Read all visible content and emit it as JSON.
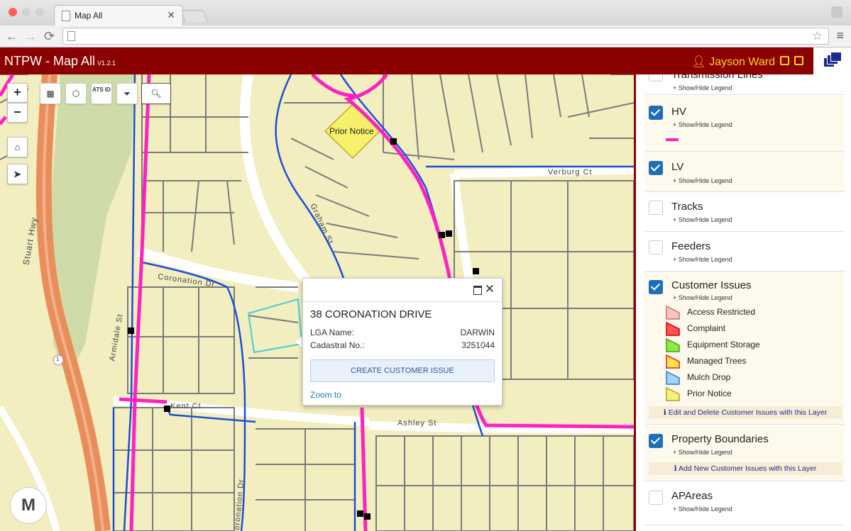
{
  "browser": {
    "tab_title": "Map All",
    "tab_close": "✕"
  },
  "app": {
    "name": "NTPW - Map All",
    "version": "V1.2.1",
    "user": "Jayson Ward",
    "colors": {
      "header": "#8b0000",
      "accent": "#ffd21a"
    }
  },
  "map": {
    "zoom_in": "+",
    "zoom_out": "−",
    "tools": {
      "grid_icon": "grid-icon",
      "lasso_icon": "lasso-icon",
      "ats_label": "ATS ID",
      "filter_icon": "filter-icon",
      "search_icon": "search-icon"
    },
    "feature_label": "Prior Notice",
    "street_labels": {
      "verburg": "Verburg Ct",
      "graham": "Graham St",
      "coronation": "Coronation Dr",
      "armidale": "Armidale St",
      "kent": "Kent Ct",
      "ashley": "Ashley St",
      "stuart": "Stuart Hwy",
      "coronation_lower": "Coronation Dr",
      "route": "1"
    }
  },
  "popup": {
    "title": "38 CORONATION DRIVE",
    "lga_label": "LGA Name:",
    "lga_value": "DARWIN",
    "cadastral_label": "Cadastral No.:",
    "cadastral_value": "3251044",
    "button": "CREATE CUSTOMER ISSUE",
    "zoom_link": "Zoom to"
  },
  "panel": {
    "transmission": {
      "name": "Transmission Lines",
      "toggle": "+ Show/Hide Legend"
    },
    "hv": {
      "name": "HV",
      "toggle": "+ Show/Hide Legend"
    },
    "lv": {
      "name": "LV",
      "toggle": "+ Show/Hide Legend"
    },
    "tracks": {
      "name": "Tracks",
      "toggle": "+ Show/Hide Legend"
    },
    "feeders": {
      "name": "Feeders",
      "toggle": "+ Show/Hide Legend"
    },
    "customer_issues": {
      "name": "Customer Issues",
      "toggle": "+ Show/Hide Legend",
      "legend": [
        {
          "label": "Access Restricted",
          "fill": "#f7c4c4",
          "stroke": "#d26a6a"
        },
        {
          "label": "Complaint",
          "fill": "#ff5555",
          "stroke": "#cc0000"
        },
        {
          "label": "Equipment Storage",
          "fill": "#8ee84a",
          "stroke": "#3fa20a"
        },
        {
          "label": "Managed Trees",
          "fill": "#ffe24a",
          "stroke": "#e02020"
        },
        {
          "label": "Mulch Drop",
          "fill": "#9fd5f5",
          "stroke": "#2a7ad0"
        },
        {
          "label": "Prior Notice",
          "fill": "#f5f07a",
          "stroke": "#b0a020"
        }
      ],
      "info": "Edit and Delete Customer Issues with this Layer"
    },
    "property_boundaries": {
      "name": "Property Boundaries",
      "toggle": "+ Show/Hide Legend",
      "info": "Add New Customer Issues with this Layer"
    },
    "apareas": {
      "name": "APAreas",
      "toggle": "+ Show/Hide Legend"
    }
  },
  "logo": {
    "text": "M"
  }
}
